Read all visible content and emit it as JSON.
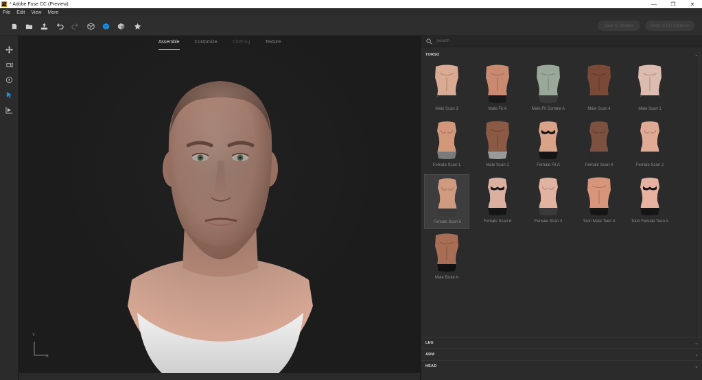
{
  "window": {
    "title": "* Adobe Fuse CC (Preview)",
    "icon_label": "Fu",
    "controls": [
      "minimize-icon",
      "restore-icon",
      "close-icon"
    ]
  },
  "menu": {
    "items": [
      "File",
      "Edit",
      "View",
      "More"
    ]
  },
  "toolbar": {
    "tools": [
      "new-icon",
      "open-icon",
      "export-icon",
      "undo-icon",
      "redo-icon",
      "cube-outline-icon",
      "cube-filled-icon",
      "cube-shaded-icon",
      "star-icon"
    ],
    "save_label": "Save to Mixamo",
    "send_label": "Send to CC Libraries"
  },
  "rail": {
    "tools": [
      "move-icon",
      "camera-icon",
      "orbit-icon",
      "select-arrow-icon",
      "animate-icon"
    ]
  },
  "viewport": {
    "tabs": [
      {
        "label": "Assemble",
        "state": "active"
      },
      {
        "label": "Customize",
        "state": "normal"
      },
      {
        "label": "Clothing",
        "state": "disabled"
      },
      {
        "label": "Texture",
        "state": "normal"
      }
    ],
    "axis": {
      "y": "Y",
      "x": "X"
    }
  },
  "panel": {
    "search_placeholder": "Search",
    "sections": {
      "torso": "TORSO",
      "leg": "LEG",
      "arm": "ARM",
      "head": "HEAD"
    },
    "items": [
      {
        "name": "Male Scan 3",
        "skin": "#d9ab95",
        "bottom": "#2a2a2a",
        "kind": "male"
      },
      {
        "name": "Male Fit A",
        "skin": "#c98a70",
        "bottom": "#1a1a1a",
        "kind": "male"
      },
      {
        "name": "Male Fit Zombie A",
        "skin": "#9aa89a",
        "bottom": "#3a3a3a",
        "kind": "male"
      },
      {
        "name": "Male Scan 4",
        "skin": "#7a4a36",
        "bottom": "#2a2a2a",
        "kind": "male"
      },
      {
        "name": "Male Scan 1",
        "skin": "#dcbcae",
        "bottom": "#2a2a2a",
        "kind": "male"
      },
      {
        "name": "Female Scan 1",
        "skin": "#d3987a",
        "bottom": "#7a7a7a",
        "kind": "female"
      },
      {
        "name": "Male Scan 2",
        "skin": "#8a5a44",
        "bottom": "#9a9a9a",
        "kind": "male"
      },
      {
        "name": "Female Fit A",
        "skin": "#d8a388",
        "bottom": "#151515",
        "kind": "female-bra"
      },
      {
        "name": "Female Scan 4",
        "skin": "#7c5140",
        "bottom": "#2a2a2a",
        "kind": "female"
      },
      {
        "name": "Female Scan 2",
        "skin": "#e0ab95",
        "bottom": "#2a2a2a",
        "kind": "female"
      },
      {
        "name": "Female Scan 5",
        "skin": "#d09a80",
        "bottom": "#3a3a3a",
        "kind": "female"
      },
      {
        "name": "Female Scan 6",
        "skin": "#dcb0a0",
        "bottom": "#151515",
        "kind": "female-bra"
      },
      {
        "name": "Female Scan 3",
        "skin": "#e3b3a2",
        "bottom": "#3a3a3a",
        "kind": "female"
      },
      {
        "name": "Toon Male Teen A",
        "skin": "#d7967c",
        "bottom": "#151515",
        "kind": "male"
      },
      {
        "name": "Toon Female Teen A",
        "skin": "#e7b3a0",
        "bottom": "#151515",
        "kind": "female-bra"
      },
      {
        "name": "Male Brute A",
        "skin": "#a86e55",
        "bottom": "#111111",
        "kind": "male"
      }
    ],
    "selected_item": "Female Scan 5"
  },
  "colors": {
    "accent": "#1e8fdf",
    "text_dim": "#8c8c8c"
  }
}
